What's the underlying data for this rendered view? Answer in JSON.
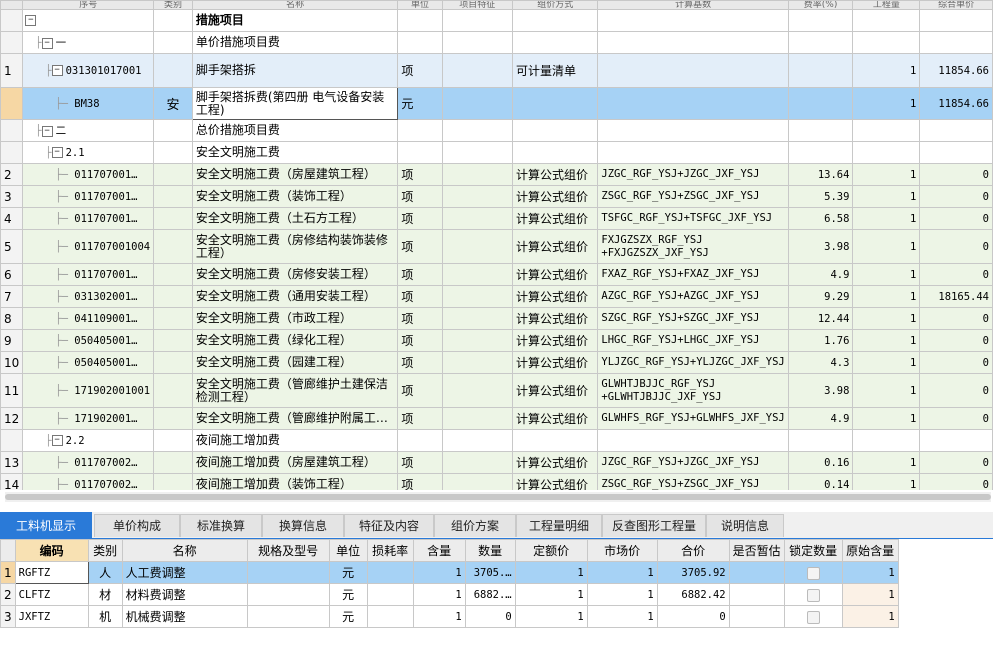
{
  "upper_header": [
    "序号",
    "类别",
    "名称",
    "单位",
    "项目特征",
    "组价方式",
    "计算基数",
    "费率(%)",
    "工程量",
    "综合单价"
  ],
  "rows": [
    {
      "no": "",
      "type": "section",
      "level": 0,
      "toggle": "−",
      "code": "",
      "cat": "",
      "name": "措施项目",
      "unit": "",
      "method": "",
      "base": "",
      "rate": "",
      "qty": "",
      "price": ""
    },
    {
      "no": "",
      "type": "section",
      "level": 1,
      "toggle": "−",
      "code": "一",
      "cat": "",
      "name": "单价措施项目费",
      "unit": "",
      "method": "",
      "base": "",
      "rate": "",
      "qty": "",
      "price": ""
    },
    {
      "no": "1",
      "type": "blue",
      "level": 2,
      "toggle": "−",
      "code": "031301017001",
      "cat": "",
      "name": "脚手架搭拆",
      "unit": "项",
      "method": "可计量清单",
      "base": "",
      "rate": "",
      "qty": "1",
      "price": "11854.66"
    },
    {
      "no": "",
      "type": "sel",
      "level": 3,
      "toggle": "",
      "code": "BM38",
      "cat": "安",
      "name": "脚手架搭拆费(第四册 电气设备安装工程)",
      "unit": "元",
      "method": "",
      "base": "",
      "rate": "",
      "qty": "1",
      "price": "11854.66"
    },
    {
      "no": "",
      "type": "section",
      "level": 1,
      "toggle": "−",
      "code": "二",
      "cat": "",
      "name": "总价措施项目费",
      "unit": "",
      "method": "",
      "base": "",
      "rate": "",
      "qty": "",
      "price": ""
    },
    {
      "no": "",
      "type": "section",
      "level": 2,
      "toggle": "−",
      "code": "2.1",
      "cat": "",
      "name": "安全文明施工费",
      "unit": "",
      "method": "",
      "base": "",
      "rate": "",
      "qty": "",
      "price": ""
    },
    {
      "no": "2",
      "type": "green",
      "level": 3,
      "toggle": "",
      "code": "011707001…",
      "cat": "",
      "name": "安全文明施工费（房屋建筑工程）",
      "unit": "项",
      "method": "计算公式组价",
      "base": "JZGC_RGF_YSJ+JZGC_JXF_YSJ",
      "rate": "13.64",
      "qty": "1",
      "price": "0"
    },
    {
      "no": "3",
      "type": "green",
      "level": 3,
      "toggle": "",
      "code": "011707001…",
      "cat": "",
      "name": "安全文明施工费（装饰工程）",
      "unit": "项",
      "method": "计算公式组价",
      "base": "ZSGC_RGF_YSJ+ZSGC_JXF_YSJ",
      "rate": "5.39",
      "qty": "1",
      "price": "0"
    },
    {
      "no": "4",
      "type": "green",
      "level": 3,
      "toggle": "",
      "code": "011707001…",
      "cat": "",
      "name": "安全文明施工费（土石方工程）",
      "unit": "项",
      "method": "计算公式组价",
      "base": "TSFGC_RGF_YSJ+TSFGC_JXF_YSJ",
      "rate": "6.58",
      "qty": "1",
      "price": "0"
    },
    {
      "no": "5",
      "type": "green",
      "level": 3,
      "toggle": "",
      "code": "011707001004",
      "cat": "",
      "name": "安全文明施工费（房修结构装饰装修工程）",
      "unit": "项",
      "method": "计算公式组价",
      "base": "FXJGZSZX_RGF_YSJ +FXJGZSZX_JXF_YSJ",
      "rate": "3.98",
      "qty": "1",
      "price": "0"
    },
    {
      "no": "6",
      "type": "green",
      "level": 3,
      "toggle": "",
      "code": "011707001…",
      "cat": "",
      "name": "安全文明施工费（房修安装工程）",
      "unit": "项",
      "method": "计算公式组价",
      "base": "FXAZ_RGF_YSJ+FXAZ_JXF_YSJ",
      "rate": "4.9",
      "qty": "1",
      "price": "0"
    },
    {
      "no": "7",
      "type": "green",
      "level": 3,
      "toggle": "",
      "code": "031302001…",
      "cat": "",
      "name": "安全文明施工费（通用安装工程）",
      "unit": "项",
      "method": "计算公式组价",
      "base": "AZGC_RGF_YSJ+AZGC_JXF_YSJ",
      "rate": "9.29",
      "qty": "1",
      "price": "18165.44"
    },
    {
      "no": "8",
      "type": "green",
      "level": 3,
      "toggle": "",
      "code": "041109001…",
      "cat": "",
      "name": "安全文明施工费（市政工程）",
      "unit": "项",
      "method": "计算公式组价",
      "base": "SZGC_RGF_YSJ+SZGC_JXF_YSJ",
      "rate": "12.44",
      "qty": "1",
      "price": "0"
    },
    {
      "no": "9",
      "type": "green",
      "level": 3,
      "toggle": "",
      "code": "050405001…",
      "cat": "",
      "name": "安全文明施工费（绿化工程）",
      "unit": "项",
      "method": "计算公式组价",
      "base": "LHGC_RGF_YSJ+LHGC_JXF_YSJ",
      "rate": "1.76",
      "qty": "1",
      "price": "0"
    },
    {
      "no": "10",
      "type": "green",
      "level": 3,
      "toggle": "",
      "code": "050405001…",
      "cat": "",
      "name": "安全文明施工费（园建工程）",
      "unit": "项",
      "method": "计算公式组价",
      "base": "YLJZGC_RGF_YSJ+YLJZGC_JXF_YSJ",
      "rate": "4.3",
      "qty": "1",
      "price": "0"
    },
    {
      "no": "11",
      "type": "green",
      "level": 3,
      "toggle": "",
      "code": "171902001001",
      "cat": "",
      "name": "安全文明施工费（管廊维护土建保洁检测工程）",
      "unit": "项",
      "method": "计算公式组价",
      "base": "GLWHTJBJJC_RGF_YSJ +GLWHTJBJJC_JXF_YSJ",
      "rate": "3.98",
      "qty": "1",
      "price": "0"
    },
    {
      "no": "12",
      "type": "green",
      "level": 3,
      "toggle": "",
      "code": "171902001…",
      "cat": "",
      "name": "安全文明施工费（管廊维护附属工程）",
      "unit": "项",
      "method": "计算公式组价",
      "base": "GLWHFS_RGF_YSJ+GLWHFS_JXF_YSJ",
      "rate": "4.9",
      "qty": "1",
      "price": "0"
    },
    {
      "no": "",
      "type": "section",
      "level": 2,
      "toggle": "−",
      "code": "2.2",
      "cat": "",
      "name": "夜间施工增加费",
      "unit": "",
      "method": "",
      "base": "",
      "rate": "",
      "qty": "",
      "price": ""
    },
    {
      "no": "13",
      "type": "green",
      "level": 3,
      "toggle": "",
      "code": "011707002…",
      "cat": "",
      "name": "夜间施工增加费（房屋建筑工程）",
      "unit": "项",
      "method": "计算公式组价",
      "base": "JZGC_RGF_YSJ+JZGC_JXF_YSJ",
      "rate": "0.16",
      "qty": "1",
      "price": "0"
    },
    {
      "no": "14",
      "type": "green",
      "level": 3,
      "toggle": "",
      "code": "011707002…",
      "cat": "",
      "name": "夜间施工增加费（装饰工程）",
      "unit": "项",
      "method": "计算公式组价",
      "base": "ZSGC_RGF_YSJ+ZSGC_JXF_YSJ",
      "rate": "0.14",
      "qty": "1",
      "price": "0"
    }
  ],
  "tabs": [
    "工料机显示",
    "单价构成",
    "标准换算",
    "换算信息",
    "特征及内容",
    "组价方案",
    "工程量明细",
    "反查图形工程量",
    "说明信息"
  ],
  "active_tab": 0,
  "lower_header": [
    "编码",
    "类别",
    "名称",
    "规格及型号",
    "单位",
    "损耗率",
    "含量",
    "数量",
    "定额价",
    "市场价",
    "合价",
    "是否暂估",
    "锁定数量",
    "原始含量"
  ],
  "lower_rows": [
    {
      "no": "1",
      "code": "RGFTZ",
      "cat": "人",
      "name": "人工费调整",
      "spec": "",
      "unit": "元",
      "loss": "",
      "content": "1",
      "qty": "3705.…",
      "quota": "1",
      "market": "1",
      "total": "3705.92",
      "est": "",
      "orig": "1"
    },
    {
      "no": "2",
      "code": "CLFTZ",
      "cat": "材",
      "name": "材料费调整",
      "spec": "",
      "unit": "元",
      "loss": "",
      "content": "1",
      "qty": "6882.…",
      "quota": "1",
      "market": "1",
      "total": "6882.42",
      "est": "",
      "orig": "1"
    },
    {
      "no": "3",
      "code": "JXFTZ",
      "cat": "机",
      "name": "机械费调整",
      "spec": "",
      "unit": "元",
      "loss": "",
      "content": "1",
      "qty": "0",
      "quota": "1",
      "market": "1",
      "total": "0",
      "est": "",
      "orig": "1"
    }
  ]
}
